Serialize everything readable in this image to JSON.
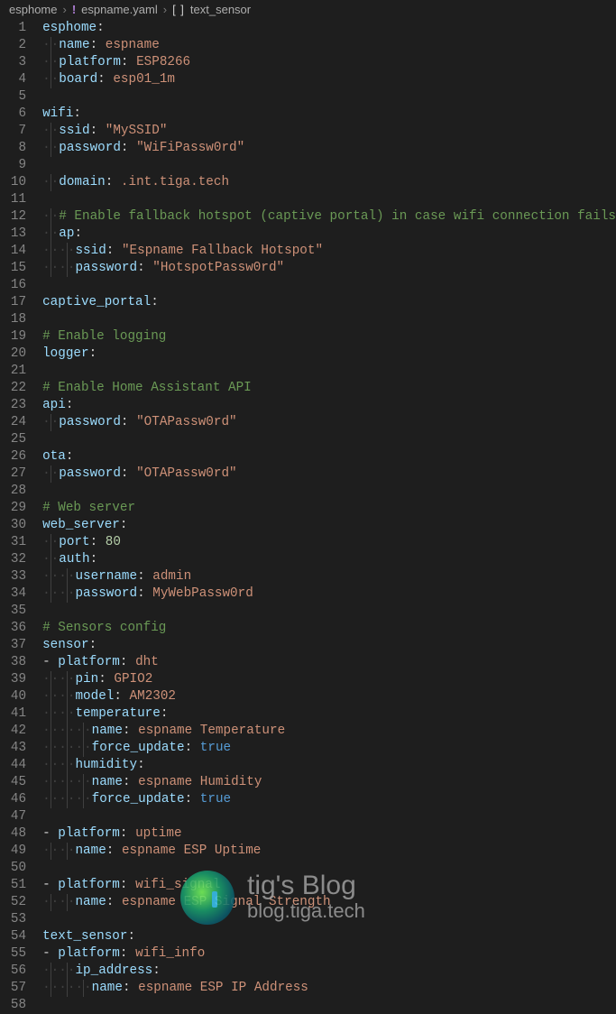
{
  "breadcrumbs": {
    "root": "esphome",
    "file": "espname.yaml",
    "symbol": "text_sensor"
  },
  "watermark": {
    "title": "tig's Blog",
    "subtitle": "blog.tiga.tech"
  },
  "lines": [
    {
      "n": 1,
      "parts": [
        {
          "t": "key",
          "v": "esphome"
        },
        {
          "t": "colon",
          "v": ":"
        }
      ]
    },
    {
      "n": 2,
      "i": 1,
      "parts": [
        {
          "t": "key",
          "v": "name"
        },
        {
          "t": "colon",
          "v": ": "
        },
        {
          "t": "val-ident",
          "v": "espname"
        }
      ]
    },
    {
      "n": 3,
      "i": 1,
      "parts": [
        {
          "t": "key",
          "v": "platform"
        },
        {
          "t": "colon",
          "v": ": "
        },
        {
          "t": "val-ident",
          "v": "ESP8266"
        }
      ]
    },
    {
      "n": 4,
      "i": 1,
      "parts": [
        {
          "t": "key",
          "v": "board"
        },
        {
          "t": "colon",
          "v": ": "
        },
        {
          "t": "val-ident",
          "v": "esp01_1m"
        }
      ]
    },
    {
      "n": 5,
      "parts": []
    },
    {
      "n": 6,
      "parts": [
        {
          "t": "key",
          "v": "wifi"
        },
        {
          "t": "colon",
          "v": ":"
        }
      ]
    },
    {
      "n": 7,
      "i": 1,
      "parts": [
        {
          "t": "key",
          "v": "ssid"
        },
        {
          "t": "colon",
          "v": ": "
        },
        {
          "t": "val-str",
          "v": "\"MySSID\""
        }
      ]
    },
    {
      "n": 8,
      "i": 1,
      "parts": [
        {
          "t": "key",
          "v": "password"
        },
        {
          "t": "colon",
          "v": ": "
        },
        {
          "t": "val-str",
          "v": "\"WiFiPassw0rd\""
        }
      ]
    },
    {
      "n": 9,
      "parts": []
    },
    {
      "n": 10,
      "i": 1,
      "parts": [
        {
          "t": "key",
          "v": "domain"
        },
        {
          "t": "colon",
          "v": ": "
        },
        {
          "t": "val-ident",
          "v": ".int.tiga.tech"
        }
      ]
    },
    {
      "n": 11,
      "parts": []
    },
    {
      "n": 12,
      "i": 1,
      "parts": [
        {
          "t": "comment",
          "v": "# Enable fallback hotspot (captive portal) in case wifi connection fails"
        }
      ]
    },
    {
      "n": 13,
      "i": 1,
      "parts": [
        {
          "t": "key",
          "v": "ap"
        },
        {
          "t": "colon",
          "v": ":"
        }
      ]
    },
    {
      "n": 14,
      "i": 2,
      "parts": [
        {
          "t": "key",
          "v": "ssid"
        },
        {
          "t": "colon",
          "v": ": "
        },
        {
          "t": "val-str",
          "v": "\"Espname Fallback Hotspot\""
        }
      ]
    },
    {
      "n": 15,
      "i": 2,
      "parts": [
        {
          "t": "key",
          "v": "password"
        },
        {
          "t": "colon",
          "v": ": "
        },
        {
          "t": "val-str",
          "v": "\"HotspotPassw0rd\""
        }
      ]
    },
    {
      "n": 16,
      "parts": []
    },
    {
      "n": 17,
      "parts": [
        {
          "t": "key",
          "v": "captive_portal"
        },
        {
          "t": "colon",
          "v": ":"
        }
      ]
    },
    {
      "n": 18,
      "parts": []
    },
    {
      "n": 19,
      "parts": [
        {
          "t": "comment",
          "v": "# Enable logging"
        }
      ]
    },
    {
      "n": 20,
      "parts": [
        {
          "t": "key",
          "v": "logger"
        },
        {
          "t": "colon",
          "v": ":"
        }
      ]
    },
    {
      "n": 21,
      "parts": []
    },
    {
      "n": 22,
      "parts": [
        {
          "t": "comment",
          "v": "# Enable Home Assistant API"
        }
      ]
    },
    {
      "n": 23,
      "parts": [
        {
          "t": "key",
          "v": "api"
        },
        {
          "t": "colon",
          "v": ":"
        }
      ]
    },
    {
      "n": 24,
      "i": 1,
      "parts": [
        {
          "t": "key",
          "v": "password"
        },
        {
          "t": "colon",
          "v": ": "
        },
        {
          "t": "val-str",
          "v": "\"OTAPassw0rd\""
        }
      ]
    },
    {
      "n": 25,
      "parts": []
    },
    {
      "n": 26,
      "parts": [
        {
          "t": "key",
          "v": "ota"
        },
        {
          "t": "colon",
          "v": ":"
        }
      ]
    },
    {
      "n": 27,
      "i": 1,
      "parts": [
        {
          "t": "key",
          "v": "password"
        },
        {
          "t": "colon",
          "v": ": "
        },
        {
          "t": "val-str",
          "v": "\"OTAPassw0rd\""
        }
      ]
    },
    {
      "n": 28,
      "parts": []
    },
    {
      "n": 29,
      "parts": [
        {
          "t": "comment",
          "v": "# Web server"
        }
      ]
    },
    {
      "n": 30,
      "parts": [
        {
          "t": "key",
          "v": "web_server"
        },
        {
          "t": "colon",
          "v": ":"
        }
      ]
    },
    {
      "n": 31,
      "i": 1,
      "parts": [
        {
          "t": "key",
          "v": "port"
        },
        {
          "t": "colon",
          "v": ": "
        },
        {
          "t": "val-num",
          "v": "80"
        }
      ]
    },
    {
      "n": 32,
      "i": 1,
      "parts": [
        {
          "t": "key",
          "v": "auth"
        },
        {
          "t": "colon",
          "v": ":"
        }
      ]
    },
    {
      "n": 33,
      "i": 2,
      "parts": [
        {
          "t": "key",
          "v": "username"
        },
        {
          "t": "colon",
          "v": ": "
        },
        {
          "t": "val-ident",
          "v": "admin"
        }
      ]
    },
    {
      "n": 34,
      "i": 2,
      "parts": [
        {
          "t": "key",
          "v": "password"
        },
        {
          "t": "colon",
          "v": ": "
        },
        {
          "t": "val-ident",
          "v": "MyWebPassw0rd"
        }
      ]
    },
    {
      "n": 35,
      "parts": []
    },
    {
      "n": 36,
      "parts": [
        {
          "t": "comment",
          "v": "# Sensors config"
        }
      ]
    },
    {
      "n": 37,
      "parts": [
        {
          "t": "key",
          "v": "sensor"
        },
        {
          "t": "colon",
          "v": ":"
        }
      ]
    },
    {
      "n": 38,
      "i": 1,
      "dash": true,
      "parts": [
        {
          "t": "key",
          "v": "platform"
        },
        {
          "t": "colon",
          "v": ": "
        },
        {
          "t": "val-ident",
          "v": "dht"
        }
      ]
    },
    {
      "n": 39,
      "i": 2,
      "parts": [
        {
          "t": "key",
          "v": "pin"
        },
        {
          "t": "colon",
          "v": ": "
        },
        {
          "t": "val-ident",
          "v": "GPIO2"
        }
      ]
    },
    {
      "n": 40,
      "i": 2,
      "parts": [
        {
          "t": "key",
          "v": "model"
        },
        {
          "t": "colon",
          "v": ": "
        },
        {
          "t": "val-ident",
          "v": "AM2302"
        }
      ]
    },
    {
      "n": 41,
      "i": 2,
      "parts": [
        {
          "t": "key",
          "v": "temperature"
        },
        {
          "t": "colon",
          "v": ":"
        }
      ]
    },
    {
      "n": 42,
      "i": 3,
      "parts": [
        {
          "t": "key",
          "v": "name"
        },
        {
          "t": "colon",
          "v": ": "
        },
        {
          "t": "val-ident",
          "v": "espname Temperature"
        }
      ]
    },
    {
      "n": 43,
      "i": 3,
      "parts": [
        {
          "t": "key",
          "v": "force_update"
        },
        {
          "t": "colon",
          "v": ": "
        },
        {
          "t": "val-bool",
          "v": "true"
        }
      ]
    },
    {
      "n": 44,
      "i": 2,
      "parts": [
        {
          "t": "key",
          "v": "humidity"
        },
        {
          "t": "colon",
          "v": ":"
        }
      ]
    },
    {
      "n": 45,
      "i": 3,
      "parts": [
        {
          "t": "key",
          "v": "name"
        },
        {
          "t": "colon",
          "v": ": "
        },
        {
          "t": "val-ident",
          "v": "espname Humidity"
        }
      ]
    },
    {
      "n": 46,
      "i": 3,
      "parts": [
        {
          "t": "key",
          "v": "force_update"
        },
        {
          "t": "colon",
          "v": ": "
        },
        {
          "t": "val-bool",
          "v": "true"
        }
      ]
    },
    {
      "n": 47,
      "parts": []
    },
    {
      "n": 48,
      "i": 1,
      "dash": true,
      "parts": [
        {
          "t": "key",
          "v": "platform"
        },
        {
          "t": "colon",
          "v": ": "
        },
        {
          "t": "val-ident",
          "v": "uptime"
        }
      ]
    },
    {
      "n": 49,
      "i": 2,
      "parts": [
        {
          "t": "key",
          "v": "name"
        },
        {
          "t": "colon",
          "v": ": "
        },
        {
          "t": "val-ident",
          "v": "espname ESP Uptime"
        }
      ]
    },
    {
      "n": 50,
      "parts": []
    },
    {
      "n": 51,
      "i": 1,
      "dash": true,
      "parts": [
        {
          "t": "key",
          "v": "platform"
        },
        {
          "t": "colon",
          "v": ": "
        },
        {
          "t": "val-ident",
          "v": "wifi_signal"
        }
      ]
    },
    {
      "n": 52,
      "i": 2,
      "parts": [
        {
          "t": "key",
          "v": "name"
        },
        {
          "t": "colon",
          "v": ": "
        },
        {
          "t": "val-ident",
          "v": "espname ESP Signal Strength"
        }
      ]
    },
    {
      "n": 53,
      "parts": []
    },
    {
      "n": 54,
      "parts": [
        {
          "t": "key",
          "v": "text_sensor"
        },
        {
          "t": "colon",
          "v": ":"
        }
      ]
    },
    {
      "n": 55,
      "i": 1,
      "dash": true,
      "parts": [
        {
          "t": "key",
          "v": "platform"
        },
        {
          "t": "colon",
          "v": ": "
        },
        {
          "t": "val-ident",
          "v": "wifi_info"
        }
      ]
    },
    {
      "n": 56,
      "i": 2,
      "parts": [
        {
          "t": "key",
          "v": "ip_address"
        },
        {
          "t": "colon",
          "v": ":"
        }
      ]
    },
    {
      "n": 57,
      "i": 3,
      "parts": [
        {
          "t": "key",
          "v": "name"
        },
        {
          "t": "colon",
          "v": ": "
        },
        {
          "t": "val-ident",
          "v": "espname ESP IP Address"
        }
      ]
    },
    {
      "n": 58,
      "parts": []
    }
  ]
}
